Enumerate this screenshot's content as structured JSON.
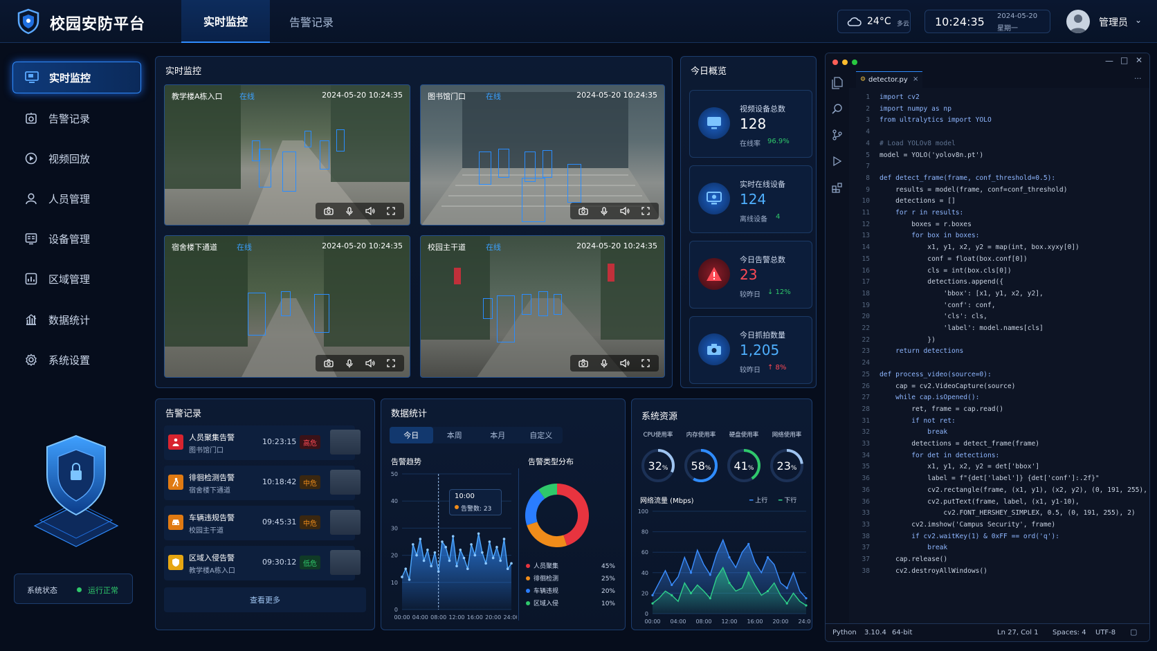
{
  "header": {
    "title": "校园安防平台",
    "tabs": [
      {
        "label": "实时监控"
      },
      {
        "label": "告警记录"
      }
    ],
    "weather": {
      "temp": "24°C",
      "cond": "多云"
    },
    "clock": {
      "time": "10:24:35",
      "date": "2024-05-20",
      "weekday": "星期一"
    },
    "user": {
      "name": "管理员"
    }
  },
  "sidebar": {
    "items": [
      {
        "label": "实时监控",
        "icon": "monitor-icon"
      },
      {
        "label": "告警记录",
        "icon": "alarm-icon"
      },
      {
        "label": "视频回放",
        "icon": "play-icon"
      },
      {
        "label": "人员管理",
        "icon": "user-icon"
      },
      {
        "label": "设备管理",
        "icon": "device-icon"
      },
      {
        "label": "区域管理",
        "icon": "region-icon"
      },
      {
        "label": "数据统计",
        "icon": "stats-icon"
      },
      {
        "label": "系统设置",
        "icon": "settings-icon"
      }
    ],
    "status_label": "系统状态",
    "status_value": "运行正常"
  },
  "live": {
    "title": "实时监控",
    "online": "在线",
    "cameras": [
      {
        "name": "教学楼A栋入口",
        "time": "2024-05-20 10:24:35"
      },
      {
        "name": "图书馆门口",
        "time": "2024-05-20 10:24:35"
      },
      {
        "name": "宿舍楼下通道",
        "time": "2024-05-20 10:24:35"
      },
      {
        "name": "校园主干道",
        "time": "2024-05-20 10:24:35"
      }
    ]
  },
  "overview": {
    "title": "今日概览",
    "cards": [
      {
        "label": "视频设备总数",
        "value": "128",
        "sub_label": "在线率",
        "sub_value": "96.9%"
      },
      {
        "label": "实时在线设备",
        "value": "124",
        "sub_label": "离线设备",
        "sub_value": "4"
      },
      {
        "label": "今日告警总数",
        "value": "23",
        "sub_label": "较昨日",
        "sub_value": "↓ 12%"
      },
      {
        "label": "今日抓拍数量",
        "value": "1,205",
        "sub_label": "较昨日",
        "sub_value": "↑ 8%"
      }
    ]
  },
  "alarms": {
    "title": "告警记录",
    "more": "查看更多",
    "rows": [
      {
        "title": "人员聚集告警",
        "loc": "图书馆门口",
        "time": "10:23:15",
        "level": "高危"
      },
      {
        "title": "徘徊检测告警",
        "loc": "宿舍楼下通道",
        "time": "10:18:42",
        "level": "中危"
      },
      {
        "title": "车辆违规告警",
        "loc": "校园主干道",
        "time": "09:45:31",
        "level": "中危"
      },
      {
        "title": "区域入侵告警",
        "loc": "教学楼A栋入口",
        "time": "09:30:12",
        "level": "低危"
      }
    ]
  },
  "stats": {
    "title": "数据统计",
    "tabs": [
      "今日",
      "本周",
      "本月",
      "自定义"
    ],
    "trend_title": "告警趋势",
    "dist_title": "告警类型分布",
    "tooltip": {
      "time": "10:00",
      "label": "告警数: 23"
    }
  },
  "resources": {
    "title": "系统资源",
    "gauges": [
      {
        "label": "CPU使用率",
        "value": "32",
        "unit": "%"
      },
      {
        "label": "内存使用率",
        "value": "58",
        "unit": "%"
      },
      {
        "label": "硬盘使用率",
        "value": "41",
        "unit": "%"
      },
      {
        "label": "网络使用率",
        "value": "23",
        "unit": "%"
      }
    ],
    "net_title": "网络流量 (Mbps)",
    "legend_up": "上行",
    "legend_down": "下行"
  },
  "chart_data": [
    {
      "type": "area",
      "title": "告警趋势",
      "x_ticks": [
        "00:00",
        "04:00",
        "08:00",
        "12:00",
        "16:00",
        "20:00",
        "24:00"
      ],
      "y_ticks": [
        0,
        10,
        20,
        30,
        40,
        50
      ],
      "ylim": [
        0,
        50
      ],
      "series": [
        {
          "values": [
            12,
            15,
            11,
            24,
            20,
            26,
            18,
            22,
            16,
            21,
            14,
            25,
            23,
            18,
            27,
            16,
            22,
            19,
            15,
            24,
            20,
            28,
            21,
            17,
            25,
            19,
            23,
            18,
            26,
            15,
            17
          ]
        }
      ]
    },
    {
      "type": "pie",
      "title": "告警类型分布",
      "categories": [
        "人员聚集",
        "徘徊检测",
        "车辆违规",
        "区域入侵"
      ],
      "values": [
        45,
        25,
        20,
        10
      ],
      "colors": [
        "#e8343f",
        "#f08c1a",
        "#2a7dff",
        "#2fc86b"
      ]
    },
    {
      "type": "area",
      "title": "网络流量 (Mbps)",
      "x_ticks": [
        "00:00",
        "04:00",
        "08:00",
        "12:00",
        "16:00",
        "20:00",
        "24:00"
      ],
      "y_ticks": [
        0,
        20,
        40,
        60,
        80,
        100
      ],
      "ylim": [
        0,
        100
      ],
      "series": [
        {
          "name": "上行",
          "color": "#3a8dff",
          "values": [
            18,
            30,
            42,
            28,
            36,
            55,
            40,
            62,
            48,
            38,
            58,
            72,
            55,
            45,
            60,
            68,
            50,
            40,
            55,
            48,
            30,
            25,
            40,
            22,
            15
          ]
        },
        {
          "name": "下行",
          "color": "#2fd08a",
          "values": [
            10,
            15,
            22,
            18,
            12,
            30,
            20,
            28,
            22,
            15,
            35,
            45,
            30,
            22,
            25,
            40,
            28,
            18,
            22,
            30,
            18,
            10,
            20,
            12,
            8
          ]
        }
      ]
    }
  ],
  "editor": {
    "filename": "detector.py",
    "lines": [
      {
        "n": "1",
        "t": "import cv2"
      },
      {
        "n": "2",
        "t": "import numpy as np"
      },
      {
        "n": "3",
        "t": "from ultralytics import YOLO"
      },
      {
        "n": "4",
        "t": ""
      },
      {
        "n": "4",
        "t": "# Load YOLOv8 model"
      },
      {
        "n": "5",
        "t": "model = YOLO('yolov8n.pt')"
      },
      {
        "n": "7",
        "t": ""
      },
      {
        "n": "8",
        "t": "def detect_frame(frame, conf_threshold=0.5):"
      },
      {
        "n": "9",
        "t": "    results = model(frame, conf=conf_threshold)"
      },
      {
        "n": "10",
        "t": "    detections = []"
      },
      {
        "n": "11",
        "t": "    for r in results:"
      },
      {
        "n": "12",
        "t": "        boxes = r.boxes"
      },
      {
        "n": "13",
        "t": "        for box in boxes:"
      },
      {
        "n": "14",
        "t": "            x1, y1, x2, y2 = map(int, box.xyxy[0])"
      },
      {
        "n": "15",
        "t": "            conf = float(box.conf[0])"
      },
      {
        "n": "16",
        "t": "            cls = int(box.cls[0])"
      },
      {
        "n": "17",
        "t": "            detections.append({"
      },
      {
        "n": "18",
        "t": "                'bbox': [x1, y1, x2, y2],"
      },
      {
        "n": "19",
        "t": "                'conf': conf,"
      },
      {
        "n": "20",
        "t": "                'cls': cls,"
      },
      {
        "n": "22",
        "t": "                'label': model.names[cls]"
      },
      {
        "n": "22",
        "t": "            })"
      },
      {
        "n": "23",
        "t": "    return detections"
      },
      {
        "n": "24",
        "t": ""
      },
      {
        "n": "25",
        "t": "def process_video(source=0):"
      },
      {
        "n": "26",
        "t": "    cap = cv2.VideoCapture(source)"
      },
      {
        "n": "27",
        "t": "    while cap.isOpened():"
      },
      {
        "n": "28",
        "t": "        ret, frame = cap.read()"
      },
      {
        "n": "31",
        "t": "        if not ret:"
      },
      {
        "n": "32",
        "t": "            break"
      },
      {
        "n": "33",
        "t": "        detections = detect_frame(frame)"
      },
      {
        "n": "34",
        "t": "        for det in detections:"
      },
      {
        "n": "35",
        "t": "            x1, y1, x2, y2 = det['bbox']"
      },
      {
        "n": "36",
        "t": "            label = f\"{det['label']} {det['conf']:.2f}\""
      },
      {
        "n": "36",
        "t": "            cv2.rectangle(frame, (x1, y1), (x2, y2), (0, 191, 255), 2)"
      },
      {
        "n": "36",
        "t": "            cv2.putText(frame, label, (x1, y1-10),"
      },
      {
        "n": "33",
        "t": "                cv2.FONT_HERSHEY_SIMPLEX, 0.5, (0, 191, 255), 2)"
      },
      {
        "n": "33",
        "t": "        cv2.imshow('Campus Security', frame)"
      },
      {
        "n": "38",
        "t": "        if cv2.waitKey(1) & 0xFF == ord('q'):"
      },
      {
        "n": "37",
        "t": "            break"
      },
      {
        "n": "37",
        "t": "    cap.release()"
      },
      {
        "n": "38",
        "t": "    cv2.destroyAllWindows()"
      }
    ],
    "status": {
      "lang": "Python",
      "ver": "3.10.4",
      "arch": "64-bit",
      "pos": "Ln 27, Col 1",
      "spaces": "Spaces: 4",
      "enc": "UTF-8"
    }
  },
  "colors": {
    "accent": "#2f8cff",
    "danger": "#e8343f",
    "warn": "#f08c1a",
    "ok": "#2fc86b"
  }
}
